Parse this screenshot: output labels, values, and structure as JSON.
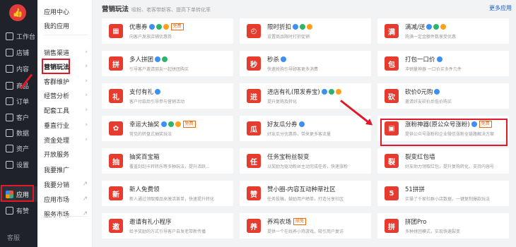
{
  "nav": {
    "logo": "👍",
    "items": [
      {
        "label": "工作台",
        "icon": "monitor-icon"
      },
      {
        "label": "店铺",
        "icon": "shop-icon"
      },
      {
        "label": "内容",
        "icon": "content-icon"
      },
      {
        "label": "商品",
        "icon": "bag-icon"
      },
      {
        "label": "订单",
        "icon": "order-icon"
      },
      {
        "label": "客户",
        "icon": "user-icon"
      },
      {
        "label": "数据",
        "icon": "chart-icon"
      },
      {
        "label": "资产",
        "icon": "yen-icon"
      },
      {
        "label": "设置",
        "icon": "gear-icon"
      },
      {
        "label": "应用",
        "icon": "apps-icon"
      },
      {
        "label": "有赞",
        "icon": "youzan-icon"
      }
    ],
    "footer": "客服"
  },
  "menu": {
    "items": [
      {
        "label": "应用中心",
        "arrow": ""
      },
      {
        "label": "我的应用",
        "arrow": ""
      },
      {
        "label": "销售渠道",
        "arrow": "›"
      },
      {
        "label": "营销玩法",
        "arrow": "›"
      },
      {
        "label": "客群维护",
        "arrow": "›"
      },
      {
        "label": "经营分析",
        "arrow": "›"
      },
      {
        "label": "配套工具",
        "arrow": "›"
      },
      {
        "label": "垂直行业",
        "arrow": "›"
      },
      {
        "label": "资金处理",
        "arrow": "›"
      },
      {
        "label": "开放服务",
        "arrow": ""
      },
      {
        "label": "我要推广",
        "arrow": ""
      },
      {
        "label": "我要分销",
        "arrow": "↗"
      },
      {
        "label": "应用市场",
        "arrow": "↗"
      },
      {
        "label": "服务市场",
        "arrow": "↗"
      }
    ]
  },
  "section": {
    "title": "营销玩法",
    "subtitle": "吸粉、老客带新客、提高下单转化率",
    "more": "更多应用"
  },
  "cards": [
    {
      "title": "优惠券",
      "desc": "向客户发放店铺优惠券",
      "icon": "▦",
      "tag": "免费",
      "badges": 3
    },
    {
      "title": "限时折扣",
      "desc": "设置商品限时打折促销",
      "icon": "◴",
      "tag": "",
      "badges": 3
    },
    {
      "title": "满减/送",
      "desc": "购满一定金额件数享受优惠",
      "icon": "满",
      "tag": "",
      "badges": 3
    },
    {
      "title": "多人拼团",
      "desc": "引导客户邀请朋友一起拼团购买",
      "icon": "拼",
      "tag": "",
      "badges": 2
    },
    {
      "title": "秒杀",
      "desc": "快速抢购引导顾客更多消费",
      "icon": "秒",
      "tag": "",
      "badges": 1
    },
    {
      "title": "打包一口价",
      "desc": "冲销量神器 一口价买多件几件",
      "icon": "包",
      "tag": "",
      "badges": 1
    },
    {
      "title": "支付有礼",
      "desc": "客户付款后引导参与营销活动",
      "icon": "礼",
      "tag": "",
      "badges": 1
    },
    {
      "title": "进店有礼(限发券宝)",
      "desc": "提升复购及转化",
      "icon": "进",
      "tag": "",
      "badges": 3
    },
    {
      "title": "砍价0元购",
      "desc": "邀请好友砍价后低价购买",
      "icon": "砍",
      "tag": "",
      "badges": 1
    },
    {
      "title": "幸运大抽奖",
      "desc": "常见的转盘式抽奖玩法",
      "icon": "✿",
      "tag": "免费",
      "badges": 3
    },
    {
      "title": "好友瓜分券",
      "desc": "好友瓜分优惠券，带来更多客流量",
      "icon": "瓜",
      "tag": "",
      "badges": 1
    },
    {
      "title": "涨粉神器(原公众号涨粉)",
      "desc": "提供公众号涨粉和企业微信涨粉全链路解决方案",
      "icon": "▣",
      "tag": "免费",
      "badges": 1
    },
    {
      "title": "抽奖百宝箱",
      "desc": "覆盖刮刮卡转转乐等多种玩法，提升活跃...",
      "icon": "抽",
      "tag": "",
      "badges": 0
    },
    {
      "title": "任务宝粉丝裂变",
      "desc": "以奖励为驱动粉丝主动完成任务，快速涨粉",
      "icon": "任",
      "tag": "",
      "badges": 0
    },
    {
      "title": "裂变红包墙",
      "desc": "好友助力领取红包，提升复购转化，支持内容号",
      "icon": "裂",
      "tag": "",
      "badges": 0
    },
    {
      "title": "新人免费领",
      "desc": "新人通过领取赠品来激活首单，快速提升转化",
      "icon": "新",
      "tag": "",
      "badges": 0
    },
    {
      "title": "赞小圈-内容互动种草社区",
      "desc": "任务投稿，鼓励用户晒单，打造分享社区",
      "icon": "赞",
      "tag": "",
      "badges": 0
    },
    {
      "title": "51拼拼",
      "desc": "实操了千家社群小店数据，一键复制爆款玩法",
      "icon": "5",
      "tag": "",
      "badges": 0
    },
    {
      "title": "邀请有礼小程序",
      "desc": "给予奖励的方式引导客户自发老带新传播",
      "icon": "邀",
      "tag": "",
      "badges": 0
    },
    {
      "title": "养鸡农场",
      "desc": "提供一个在线养小鸡游戏，吸引用户复访",
      "icon": "养",
      "tag": "限免",
      "badges": 0
    },
    {
      "title": "拼团Pro",
      "desc": "多种拼团模式，实现快速裂变",
      "icon": "拼",
      "tag": "",
      "badges": 0
    }
  ]
}
